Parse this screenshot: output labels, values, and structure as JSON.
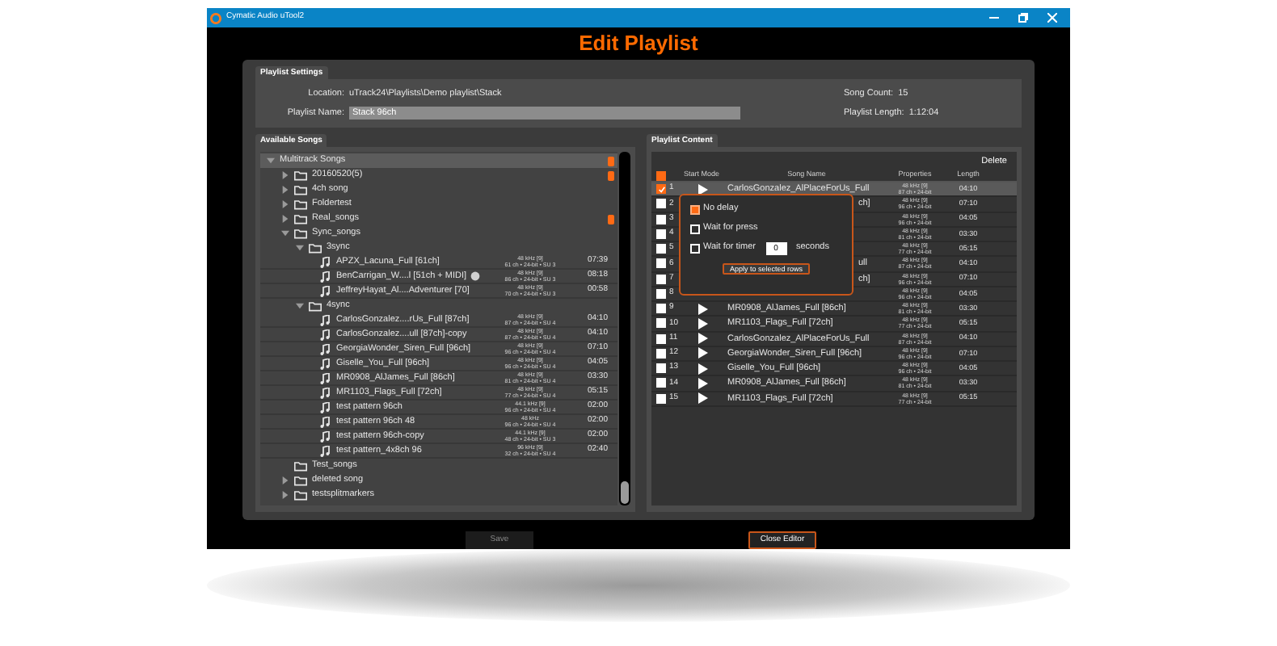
{
  "window": {
    "title": "Cymatic Audio uTool2"
  },
  "page_title": "Edit Playlist",
  "playlist_settings": {
    "title": "Playlist Settings",
    "location_label": "Location:",
    "location": "uTrack24\\Playlists\\Demo playlist\\Stack",
    "name_label": "Playlist Name:",
    "name": "Stack 96ch",
    "song_count_label": "Song Count:",
    "song_count": "15",
    "length_label": "Playlist Length:",
    "length": "1:12:04"
  },
  "available_songs": {
    "title": "Available Songs",
    "tree": [
      {
        "kind": "root",
        "label": "Multitrack Songs",
        "expanded": true,
        "selected": true,
        "flagged": true,
        "children": [
          {
            "kind": "folder",
            "label": "20160520(5)",
            "expanded": false,
            "selected": false,
            "flagged": true
          },
          {
            "kind": "folder",
            "label": "4ch song",
            "expanded": false,
            "selected": false,
            "flagged": false
          },
          {
            "kind": "folder",
            "label": "Foldertest",
            "expanded": false,
            "selected": false,
            "flagged": false
          },
          {
            "kind": "folder",
            "label": "Real_songs",
            "expanded": false,
            "selected": false,
            "flagged": true
          },
          {
            "kind": "folder",
            "label": "Sync_songs",
            "expanded": true,
            "selected": false,
            "flagged": false,
            "children": [
              {
                "kind": "folder",
                "label": "3sync",
                "expanded": true,
                "selected": false,
                "flagged": false,
                "children": [
                  {
                    "kind": "song",
                    "label": "APZX_Lacuna_Full [61ch]",
                    "midi": false,
                    "properties": [
                      "48 kHz [9]",
                      "61 ch • 24-bit • SU 3"
                    ],
                    "length": "07:39"
                  },
                  {
                    "kind": "song",
                    "label": "BenCarrigan_W....l [51ch + MIDI]",
                    "midi": true,
                    "properties": [
                      "48 kHz [9]",
                      "86 ch • 24-bit • SU 3"
                    ],
                    "length": "08:18"
                  },
                  {
                    "kind": "song",
                    "label": "JeffreyHayat_Al....Adventurer [70]",
                    "midi": false,
                    "properties": [
                      "48 kHz [9]",
                      "70 ch • 24-bit • SU 3"
                    ],
                    "length": "00:58"
                  }
                ]
              },
              {
                "kind": "folder",
                "label": "4sync",
                "expanded": true,
                "selected": false,
                "flagged": false,
                "children": [
                  {
                    "kind": "song",
                    "label": "CarlosGonzalez....rUs_Full [87ch]",
                    "midi": false,
                    "properties": [
                      "48 kHz [9]",
                      "87 ch • 24-bit • SU 4"
                    ],
                    "length": "04:10"
                  },
                  {
                    "kind": "song",
                    "label": "CarlosGonzalez....ull [87ch]-copy",
                    "midi": false,
                    "properties": [
                      "48 kHz [9]",
                      "87 ch • 24-bit • SU 4"
                    ],
                    "length": "04:10"
                  },
                  {
                    "kind": "song",
                    "label": "GeorgiaWonder_Siren_Full [96ch]",
                    "midi": false,
                    "properties": [
                      "48 kHz [9]",
                      "96 ch • 24-bit • SU 4"
                    ],
                    "length": "07:10"
                  },
                  {
                    "kind": "song",
                    "label": "Giselle_You_Full [96ch]",
                    "midi": false,
                    "properties": [
                      "48 kHz [9]",
                      "96 ch • 24-bit • SU 4"
                    ],
                    "length": "04:05"
                  },
                  {
                    "kind": "song",
                    "label": "MR0908_AlJames_Full [86ch]",
                    "midi": false,
                    "properties": [
                      "48 kHz [9]",
                      "81 ch • 24-bit • SU 4"
                    ],
                    "length": "03:30"
                  },
                  {
                    "kind": "song",
                    "label": "MR1103_Flags_Full [72ch]",
                    "midi": false,
                    "properties": [
                      "48 kHz [9]",
                      "77 ch • 24-bit • SU 4"
                    ],
                    "length": "05:15"
                  },
                  {
                    "kind": "song",
                    "label": "test pattern 96ch",
                    "midi": false,
                    "properties": [
                      "44.1 kHz [9]",
                      "96 ch • 24-bit • SU 4"
                    ],
                    "length": "02:00"
                  },
                  {
                    "kind": "song",
                    "label": "test pattern 96ch 48",
                    "midi": false,
                    "properties": [
                      "48 kHz",
                      "96 ch • 24-bit • SU 4"
                    ],
                    "length": "02:00"
                  },
                  {
                    "kind": "song",
                    "label": "test pattern 96ch-copy",
                    "midi": false,
                    "properties": [
                      "44.1 kHz [9]",
                      "48 ch • 24-bit • SU 3"
                    ],
                    "length": "02:00"
                  },
                  {
                    "kind": "song",
                    "label": "test pattern_4x8ch 96",
                    "midi": false,
                    "properties": [
                      "96 kHz [9]",
                      "32 ch • 24-bit • SU 4"
                    ],
                    "length": "02:40"
                  }
                ]
              }
            ]
          },
          {
            "kind": "folder",
            "label": "Test_songs",
            "selected": false,
            "flagged": false
          },
          {
            "kind": "folder",
            "label": "deleted song",
            "expanded": false,
            "selected": false,
            "flagged": false
          },
          {
            "kind": "folder",
            "label": "testsplitmarkers",
            "expanded": false,
            "selected": false,
            "flagged": false
          }
        ]
      }
    ]
  },
  "playlist_content": {
    "title": "Playlist Content",
    "delete_label": "Delete",
    "all_checked": true,
    "columns": [
      "Start Mode",
      "Song Name",
      "Properties",
      "Length"
    ],
    "rows": [
      {
        "number": "1",
        "checked": true,
        "selected": true,
        "play_icon": true,
        "name": "CarlosGonzalez_AlPlaceForUs_Full",
        "properties": [
          "48 kHz [9]",
          "87 ch • 24-bit"
        ],
        "length": "04:10"
      },
      {
        "number": "2",
        "checked": false,
        "selected": false,
        "play_icon": false,
        "name": "ch]",
        "name_partial": true,
        "properties": [
          "48 kHz [9]",
          "96 ch • 24-bit"
        ],
        "length": "07:10"
      },
      {
        "number": "3",
        "checked": false,
        "selected": false,
        "play_icon": false,
        "properties": [
          "48 kHz [9]",
          "96 ch • 24-bit"
        ],
        "length": "04:05"
      },
      {
        "number": "4",
        "checked": false,
        "selected": false,
        "play_icon": false,
        "properties": [
          "48 kHz [9]",
          "81 ch • 24-bit"
        ],
        "length": "03:30"
      },
      {
        "number": "5",
        "checked": false,
        "selected": false,
        "play_icon": false,
        "properties": [
          "48 kHz [9]",
          "77 ch • 24-bit"
        ],
        "length": "05:15"
      },
      {
        "number": "6",
        "checked": false,
        "selected": false,
        "play_icon": false,
        "name": "ull",
        "name_partial": true,
        "properties": [
          "48 kHz [9]",
          "87 ch • 24-bit"
        ],
        "length": "04:10"
      },
      {
        "number": "7",
        "checked": false,
        "selected": false,
        "play_icon": false,
        "name": "ch]",
        "name_partial": true,
        "properties": [
          "48 kHz [9]",
          "96 ch • 24-bit"
        ],
        "length": "07:10"
      },
      {
        "number": "8",
        "checked": false,
        "selected": false,
        "play_icon": false,
        "properties": [
          "48 kHz [9]",
          "96 ch • 24-bit"
        ],
        "length": "04:05"
      },
      {
        "number": "9",
        "checked": false,
        "selected": false,
        "play_icon": true,
        "name": "MR0908_AlJames_Full [86ch]",
        "properties": [
          "48 kHz [9]",
          "81 ch • 24-bit"
        ],
        "length": "03:30"
      },
      {
        "number": "10",
        "checked": false,
        "selected": false,
        "play_icon": true,
        "name": "MR1103_Flags_Full [72ch]",
        "properties": [
          "48 kHz [9]",
          "77 ch • 24-bit"
        ],
        "length": "05:15"
      },
      {
        "number": "11",
        "checked": false,
        "selected": false,
        "play_icon": true,
        "name": "CarlosGonzalez_AlPlaceForUs_Full",
        "properties": [
          "48 kHz [9]",
          "87 ch • 24-bit"
        ],
        "length": "04:10"
      },
      {
        "number": "12",
        "checked": false,
        "selected": false,
        "play_icon": true,
        "name": "GeorgiaWonder_Siren_Full [96ch]",
        "properties": [
          "48 kHz [9]",
          "96 ch • 24-bit"
        ],
        "length": "07:10"
      },
      {
        "number": "13",
        "checked": false,
        "selected": false,
        "play_icon": true,
        "name": "Giselle_You_Full [96ch]",
        "properties": [
          "48 kHz [9]",
          "96 ch • 24-bit"
        ],
        "length": "04:05"
      },
      {
        "number": "14",
        "checked": false,
        "selected": false,
        "play_icon": true,
        "name": "MR0908_AlJames_Full [86ch]",
        "properties": [
          "48 kHz [9]",
          "81 ch • 24-bit"
        ],
        "length": "03:30"
      },
      {
        "number": "15",
        "checked": false,
        "selected": false,
        "play_icon": true,
        "name": "MR1103_Flags_Full [72ch]",
        "properties": [
          "48 kHz [9]",
          "77 ch • 24-bit"
        ],
        "length": "05:15"
      }
    ],
    "start_mode_popup": {
      "options": [
        {
          "label": "No delay",
          "checked": true
        },
        {
          "label": "Wait for press",
          "checked": false
        },
        {
          "label": "Wait for timer",
          "checked": false,
          "timer_value": "0",
          "unit": "seconds"
        }
      ],
      "apply_button": "Apply to selected rows"
    }
  },
  "buttons": [
    {
      "label": "Save",
      "disabled": true
    },
    {
      "label": "Close Editor",
      "disabled": false
    }
  ]
}
